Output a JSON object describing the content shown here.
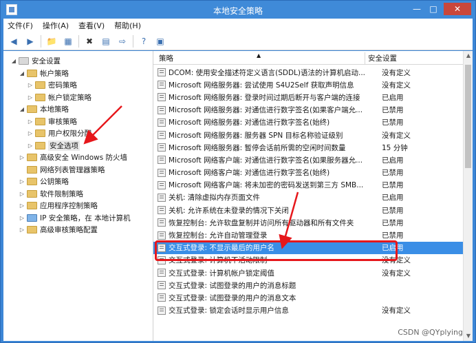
{
  "window": {
    "title": "本地安全策略"
  },
  "menu": [
    "文件(F)",
    "操作(A)",
    "查看(V)",
    "帮助(H)"
  ],
  "tree": [
    {
      "label": "安全设置",
      "level": 0,
      "tw": "◢",
      "icon": "gear"
    },
    {
      "label": "帐户策略",
      "level": 1,
      "tw": "◢",
      "icon": "folder"
    },
    {
      "label": "密码策略",
      "level": 2,
      "tw": "▷",
      "icon": "folder"
    },
    {
      "label": "帐户锁定策略",
      "level": 2,
      "tw": "▷",
      "icon": "folder"
    },
    {
      "label": "本地策略",
      "level": 1,
      "tw": "◢",
      "icon": "folder"
    },
    {
      "label": "审核策略",
      "level": 2,
      "tw": "▷",
      "icon": "folder"
    },
    {
      "label": "用户权限分配",
      "level": 2,
      "tw": "▷",
      "icon": "folder"
    },
    {
      "label": "安全选项",
      "level": 2,
      "tw": "▷",
      "icon": "folder",
      "selected": true
    },
    {
      "label": "高级安全 Windows 防火墙",
      "level": 1,
      "tw": "▷",
      "icon": "folder"
    },
    {
      "label": "网络列表管理器策略",
      "level": 1,
      "tw": "",
      "icon": "folder"
    },
    {
      "label": "公钥策略",
      "level": 1,
      "tw": "▷",
      "icon": "folder"
    },
    {
      "label": "软件限制策略",
      "level": 1,
      "tw": "▷",
      "icon": "folder"
    },
    {
      "label": "应用程序控制策略",
      "level": 1,
      "tw": "▷",
      "icon": "folder"
    },
    {
      "label": "IP 安全策略，在 本地计算机",
      "level": 1,
      "tw": "▷",
      "icon": "ip"
    },
    {
      "label": "高级审核策略配置",
      "level": 1,
      "tw": "▷",
      "icon": "folder"
    }
  ],
  "list": {
    "col_policy": "策略",
    "col_setting": "安全设置",
    "rows": [
      {
        "policy": "DCOM: 使用安全描述符定义语言(SDDL)语法的计算机启动...",
        "setting": "没有定义"
      },
      {
        "policy": "Microsoft 网络服务器: 尝试使用 S4U2Self 获取声明信息",
        "setting": "没有定义"
      },
      {
        "policy": "Microsoft 网络服务器: 登录时间过期后断开与客户端的连接",
        "setting": "已启用"
      },
      {
        "policy": "Microsoft 网络服务器: 对通信进行数字签名(如果客户端允...",
        "setting": "已禁用"
      },
      {
        "policy": "Microsoft 网络服务器: 对通信进行数字签名(始终)",
        "setting": "已禁用"
      },
      {
        "policy": "Microsoft 网络服务器: 服务器 SPN 目标名称验证级别",
        "setting": "没有定义"
      },
      {
        "policy": "Microsoft 网络服务器: 暂停会话前所需的空闲时间数量",
        "setting": "15 分钟"
      },
      {
        "policy": "Microsoft 网络客户端: 对通信进行数字签名(如果服务器允...",
        "setting": "已启用"
      },
      {
        "policy": "Microsoft 网络客户端: 对通信进行数字签名(始终)",
        "setting": "已禁用"
      },
      {
        "policy": "Microsoft 网络客户端: 将未加密的密码发送到第三方 SMB...",
        "setting": "已禁用"
      },
      {
        "policy": "关机: 清除虚拟内存页面文件",
        "setting": "已启用"
      },
      {
        "policy": "关机: 允许系统在未登录的情况下关闭",
        "setting": "已禁用"
      },
      {
        "policy": "恢复控制台: 允许软盘复制并访问所有驱动器和所有文件夹",
        "setting": "已禁用"
      },
      {
        "policy": "恢复控制台: 允许自动管理登录",
        "setting": "已禁用"
      },
      {
        "policy": "交互式登录: 不显示最后的用户名",
        "setting": "已启用",
        "selected": true
      },
      {
        "policy": "交互式登录: 计算机不活动限制",
        "setting": "没有定义"
      },
      {
        "policy": "交互式登录: 计算机帐户锁定阈值",
        "setting": "没有定义"
      },
      {
        "policy": "交互式登录: 试图登录的用户的消息标题",
        "setting": ""
      },
      {
        "policy": "交互式登录: 试图登录的用户的消息文本",
        "setting": ""
      },
      {
        "policy": "交互式登录: 锁定会话时显示用户信息",
        "setting": "没有定义"
      }
    ]
  },
  "watermark": "CSDN @QYplying",
  "colors": {
    "highlight_box": "#e6171b",
    "selection": "#3a8ee6",
    "titlebar": "#3f8ad8"
  }
}
